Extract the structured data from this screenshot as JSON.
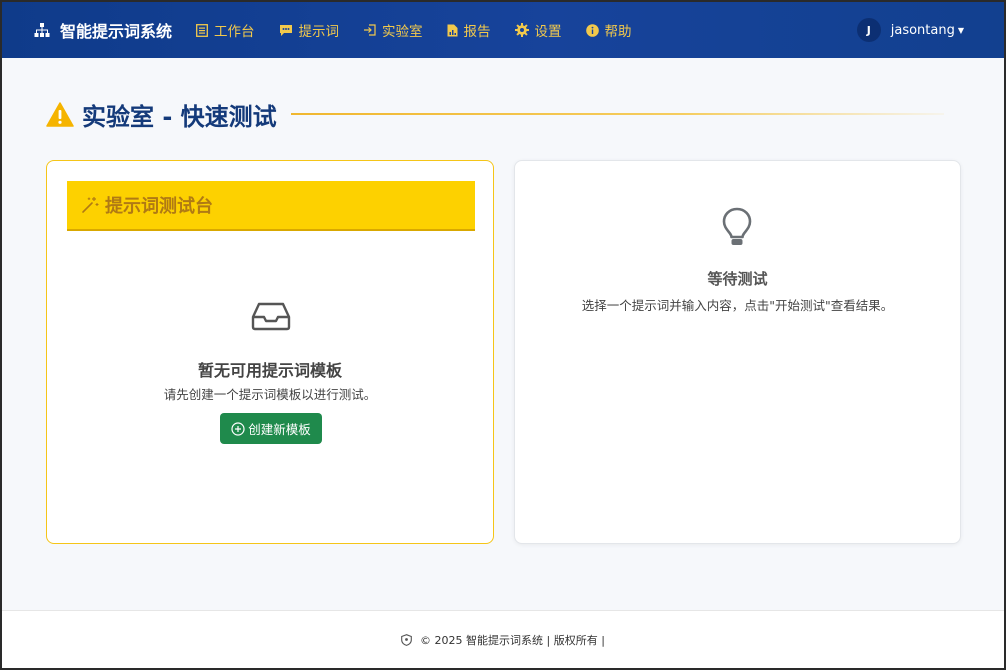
{
  "brand": {
    "name": "智能提示词系统",
    "icon": "sitemap-icon"
  },
  "nav": {
    "items": [
      {
        "label": "工作台",
        "icon": "document-icon"
      },
      {
        "label": "提示词",
        "icon": "chat-icon"
      },
      {
        "label": "实验室",
        "icon": "sign-in-icon"
      },
      {
        "label": "报告",
        "icon": "report-icon"
      },
      {
        "label": "设置",
        "icon": "gear-icon"
      },
      {
        "label": "帮助",
        "icon": "info-icon"
      }
    ]
  },
  "user": {
    "initial": "J",
    "name": "jasontang"
  },
  "page": {
    "title": "实验室 - 快速测试",
    "icon": "warning-icon"
  },
  "left_card": {
    "header": "提示词测试台",
    "header_icon": "magic-wand-icon",
    "empty_title": "暂无可用提示词模板",
    "empty_desc": "请先创建一个提示词模板以进行测试。",
    "create_button": "创建新模板"
  },
  "right_card": {
    "title": "等待测试",
    "desc": "选择一个提示词并输入内容，点击\"开始测试\"查看结果。",
    "icon": "lightbulb-icon"
  },
  "footer": {
    "text": "© 2025 智能提示词系统 | 版权所有 |"
  },
  "colors": {
    "navbar": "#17439b",
    "nav_text": "#f2c94c",
    "accent_yellow": "#fdd100",
    "title_blue": "#143a7a",
    "button_green": "#1f8a4c"
  }
}
